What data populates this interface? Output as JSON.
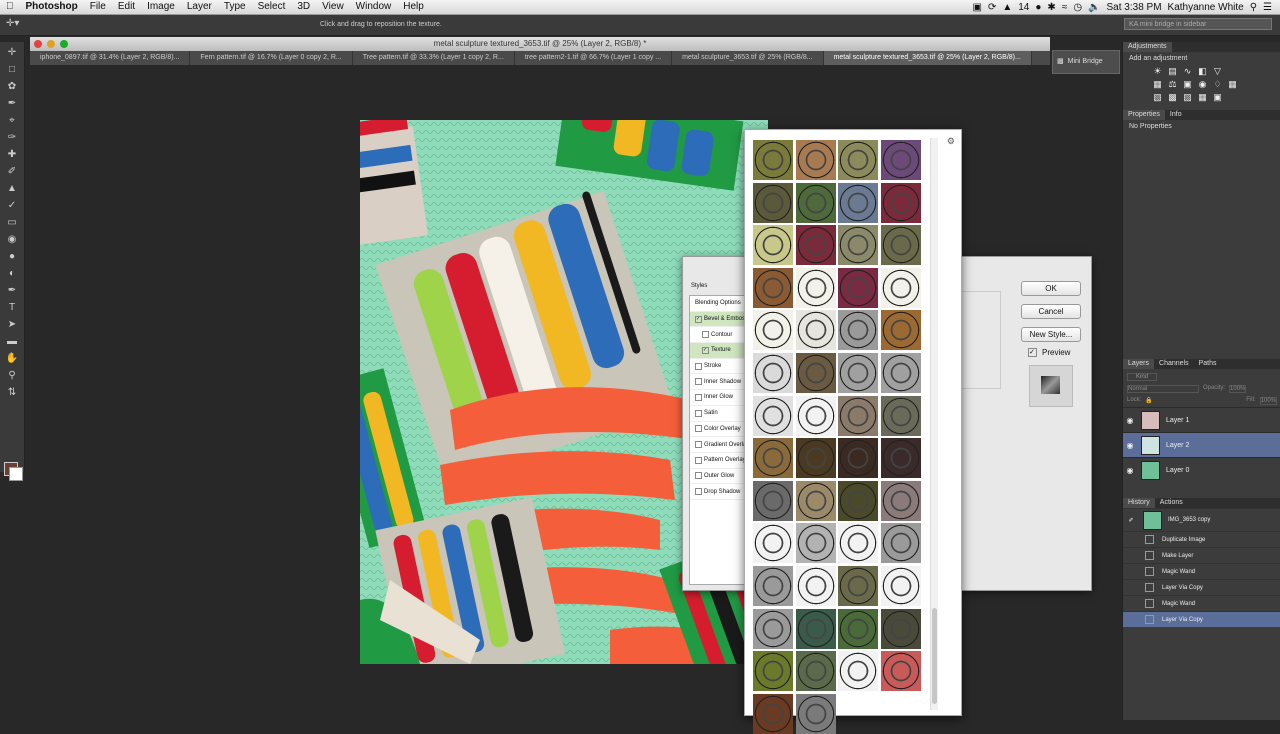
{
  "menubar": {
    "app": "Photoshop",
    "items": [
      "File",
      "Edit",
      "Image",
      "Layer",
      "Type",
      "Select",
      "3D",
      "View",
      "Window",
      "Help"
    ],
    "status_number": "14",
    "clock": "Sat 3:38 PM",
    "user": "Kathyanne White"
  },
  "options_bar": {
    "hint": "Click and drag to reposition the texture.",
    "mini_bridge_hint": "KA mini bridge in sidebar"
  },
  "document": {
    "title": "metal sculpture textured_3653.tif @ 25% (Layer 2, RGB/8) *",
    "tabs": [
      "iphone_0897.tif @ 31.4% (Layer 2, RGB/8)...",
      "Fern pattern.tif @ 16.7% (Layer 0 copy 2, R...",
      "Tree pattern.tif @ 33.3% (Layer 1 copy 2, R...",
      "tree pattern2-1.tif @ 66.7% (Layer 1 copy ...",
      "metal sculpture_3653.tif @ 25% (RGB/8...",
      "metal sculpture textured_3653.tif @ 25% (Layer 2, RGB/8)..."
    ],
    "active_tab_index": 5
  },
  "mini_bridge": {
    "label": "Mini Bridge"
  },
  "adjustments": {
    "tab": "Adjustments",
    "subtitle": "Add an adjustment"
  },
  "properties": {
    "tabs": [
      "Properties",
      "Info"
    ],
    "text": "No Properties"
  },
  "layers": {
    "tabs": [
      "Layers",
      "Channels",
      "Paths"
    ],
    "kind": "Kind",
    "blend_mode": "Normal",
    "opacity_label": "Opacity:",
    "opacity_value": "100%",
    "lock_label": "Lock:",
    "fill_label": "Fill:",
    "fill_value": "100%",
    "items": [
      {
        "name": "Layer 1",
        "color": "#d8bcbc",
        "selected": false
      },
      {
        "name": "Layer 2",
        "color": "#cfe4e0",
        "selected": true
      },
      {
        "name": "Layer 0",
        "color": "#6fbf98",
        "selected": false
      }
    ]
  },
  "history": {
    "tabs": [
      "History",
      "Actions"
    ],
    "snapshot": "IMG_3653 copy",
    "items": [
      "Duplicate Image",
      "Make Layer",
      "Magic Wand",
      "Layer Via Copy",
      "Magic Wand",
      "Layer Via Copy"
    ],
    "selected_index": 5
  },
  "layer_style": {
    "list_title": "Styles",
    "items": [
      {
        "label": "Blending Options",
        "check": false,
        "checkbox": false,
        "sub": false,
        "hl": false
      },
      {
        "label": "Bevel & Emboss",
        "check": true,
        "checkbox": true,
        "sub": false,
        "hl": true
      },
      {
        "label": "Contour",
        "check": false,
        "checkbox": true,
        "sub": true,
        "hl": false
      },
      {
        "label": "Texture",
        "check": true,
        "checkbox": true,
        "sub": true,
        "hl": true
      },
      {
        "label": "Stroke",
        "check": false,
        "checkbox": true,
        "sub": false,
        "hl": false
      },
      {
        "label": "Inner Shadow",
        "check": false,
        "checkbox": true,
        "sub": false,
        "hl": false
      },
      {
        "label": "Inner Glow",
        "check": false,
        "checkbox": true,
        "sub": false,
        "hl": false
      },
      {
        "label": "Satin",
        "check": false,
        "checkbox": true,
        "sub": false,
        "hl": false
      },
      {
        "label": "Color Overlay",
        "check": false,
        "checkbox": true,
        "sub": false,
        "hl": false
      },
      {
        "label": "Gradient Overlay",
        "check": false,
        "checkbox": true,
        "sub": false,
        "hl": false
      },
      {
        "label": "Pattern Overlay",
        "check": false,
        "checkbox": true,
        "sub": false,
        "hl": false
      },
      {
        "label": "Outer Glow",
        "check": false,
        "checkbox": true,
        "sub": false,
        "hl": false
      },
      {
        "label": "Drop Shadow",
        "check": false,
        "checkbox": true,
        "sub": false,
        "hl": false
      }
    ],
    "ok": "OK",
    "cancel": "Cancel",
    "new_style": "New Style...",
    "preview": "Preview"
  },
  "pattern_picker": {
    "swatches": [
      "#7a7a3a",
      "#a87a52",
      "#8a8a5a",
      "#6b4a7a",
      "#5a5a3a",
      "#4e6a3a",
      "#6a7a92",
      "#7a2a3a",
      "#c8c88a",
      "#7a2a3a",
      "#8a8a6a",
      "#6a6a4a",
      "#8a5a32",
      "#f2f2ea",
      "#7a2a42",
      "#f2f2ea",
      "#f2f2ea",
      "#e6e6de",
      "#9a9a9a",
      "#9a6a32",
      "#dadada",
      "#6a5a42",
      "#a0a0a0",
      "#a0a0a0",
      "#e0e0e0",
      "#f2f2f2",
      "#8a7a6a",
      "#6a6a5a",
      "#8a6a3a",
      "#4a3a22",
      "#3a2a22",
      "#3a2a2a",
      "#6a6a6a",
      "#9a8a6a",
      "#4a4a2a",
      "#8a7a7a",
      "#f2f2f2",
      "#b2b2b2",
      "#f2f2f2",
      "#9a9a9a",
      "#9a9a9a",
      "#f2f2f2",
      "#6a6a4a",
      "#f2f2f2",
      "#9a9a9a",
      "#3a5a4a",
      "#4a6a3a",
      "#4a4a3a",
      "#6a7a2a",
      "#5a6a4a",
      "#f2f2f2",
      "#c85a5a",
      "#6a3a22",
      "#7a7a7a"
    ]
  }
}
